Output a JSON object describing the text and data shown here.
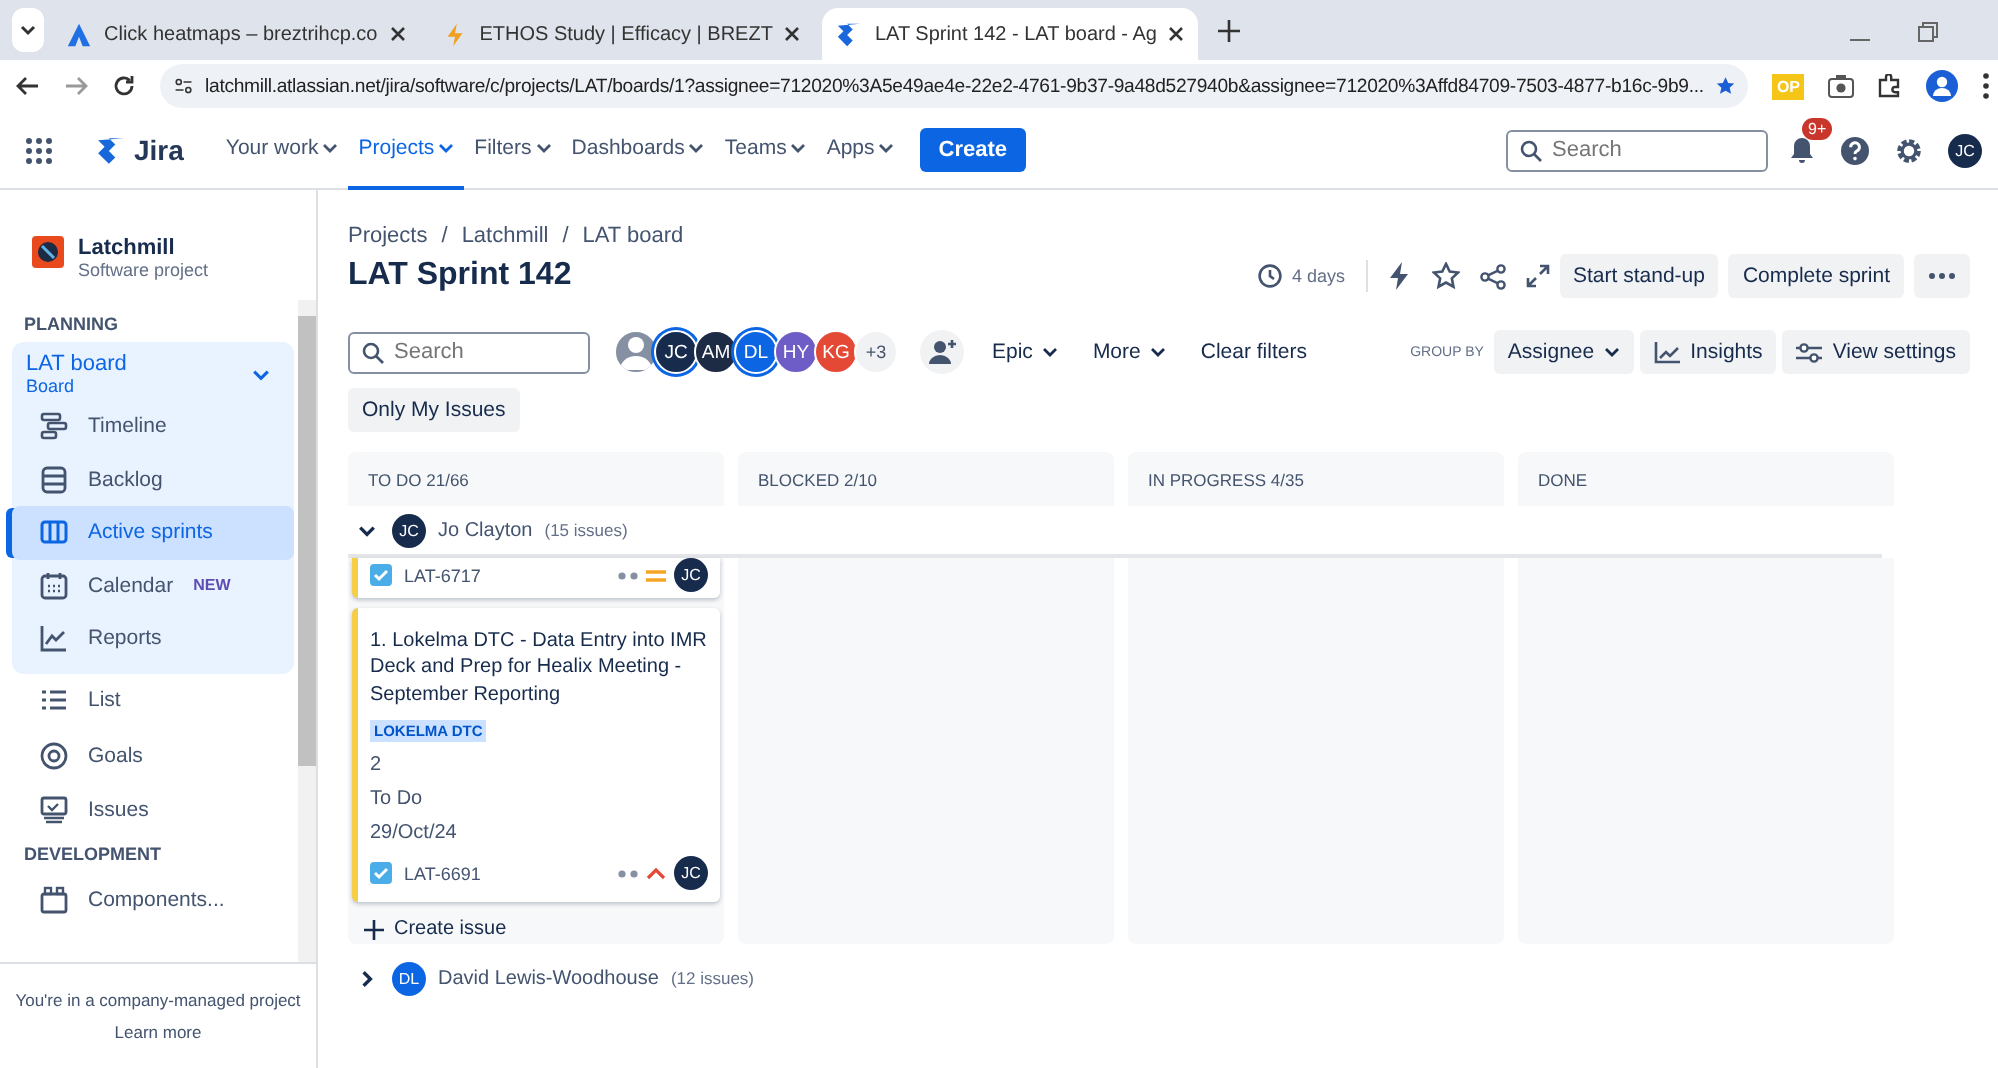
{
  "browser": {
    "tabs": [
      {
        "title": "Click heatmaps – breztrihcp.co",
        "kind": "triangle",
        "selected": false
      },
      {
        "title": "ETHOS Study | Efficacy | BREZT",
        "kind": "bolt",
        "selected": false
      },
      {
        "title": "LAT Sprint 142 - LAT board - Ag",
        "kind": "jira",
        "selected": true
      }
    ],
    "url": "latchmill.atlassian.net/jira/software/c/projects/LAT/boards/1?assignee=712020%3A5e49ae4e-22e2-4761-9b37-9a48d527940b&assignee=712020%3Affd84709-7503-4877-b16c-9b9...",
    "extension_badge": "OP"
  },
  "topnav": {
    "product": "Jira",
    "menus": [
      {
        "label": "Your work",
        "selected": false
      },
      {
        "label": "Projects",
        "selected": true
      },
      {
        "label": "Filters",
        "selected": false
      },
      {
        "label": "Dashboards",
        "selected": false
      },
      {
        "label": "Teams",
        "selected": false
      },
      {
        "label": "Apps",
        "selected": false
      }
    ],
    "create": "Create",
    "search_placeholder": "Search",
    "notifications": "9+",
    "user": "JC"
  },
  "sidebar": {
    "project": "Latchmill",
    "project_type": "Software project",
    "sections": [
      {
        "title": "PLANNING",
        "board": {
          "title": "LAT board",
          "subtitle": "Board",
          "expanded": true,
          "items": [
            {
              "label": "Timeline",
              "kind": "timeline",
              "selected": false
            },
            {
              "label": "Backlog",
              "kind": "backlog",
              "selected": false
            },
            {
              "label": "Active sprints",
              "kind": "columns",
              "selected": true
            },
            {
              "label": "Calendar",
              "kind": "calendar",
              "selected": false,
              "badge": "NEW"
            },
            {
              "label": "Reports",
              "kind": "chart",
              "selected": false
            }
          ]
        },
        "items": [
          {
            "label": "List",
            "kind": "list",
            "selected": false
          },
          {
            "label": "Goals",
            "kind": "target",
            "selected": false
          },
          {
            "label": "Issues",
            "kind": "issues",
            "selected": false
          }
        ]
      },
      {
        "title": "DEVELOPMENT",
        "items": [
          {
            "label": "Components...",
            "kind": "component",
            "selected": false
          }
        ]
      }
    ],
    "footer": "You're in a company-managed project",
    "footer_link": "Learn more"
  },
  "page": {
    "breadcrumbs": [
      "Projects",
      "Latchmill",
      "LAT board"
    ],
    "breadcrumb_separator": "/",
    "title": "LAT Sprint 142",
    "remaining": "4 days",
    "actions": [
      "Start stand-up",
      "Complete sprint"
    ],
    "filters": {
      "search_placeholder": "Search",
      "avatars": [
        {
          "color": "#8590a2",
          "selected": false
        },
        {
          "initials": "JC",
          "color": "#172b4d",
          "selected": true
        },
        {
          "initials": "AM",
          "color": "#1d2b45",
          "selected": false
        },
        {
          "initials": "DL",
          "color": "#0c66e4",
          "selected": true
        },
        {
          "initials": "HY",
          "color": "#6e5dc6",
          "selected": false
        },
        {
          "initials": "KG",
          "color": "#e34935",
          "selected": false
        }
      ],
      "more_count": "+3",
      "dropdowns": [
        "Epic",
        "More"
      ],
      "clear": "Clear filters",
      "group_by_label": "GROUP BY",
      "group_by": "Assignee",
      "insights": "Insights",
      "view_settings": "View settings",
      "only_mine": "Only My Issues"
    },
    "columns": [
      "TO DO 21/66",
      "BLOCKED 2/10",
      "IN PROGRESS 4/35",
      "DONE"
    ],
    "swimlanes": [
      {
        "initials": "JC",
        "color": "#172b4d",
        "name": "Jo Clayton",
        "count": "(15 issues)",
        "expanded": true,
        "cards": [
          {
            "kind": "stub",
            "key": "LAT-6717",
            "priority": {
              "kind": "medium"
            },
            "assignee": "JC"
          },
          {
            "kind": "full",
            "summary": "1. Lokelma DTC - Data Entry into IMR Deck and Prep for Healix Meeting - September Reporting",
            "epic": "LOKELMA DTC",
            "points": "2",
            "status": "To Do",
            "date": "29/Oct/24",
            "key": "LAT-6691",
            "priority": {
              "kind": "high"
            },
            "assignee": "JC"
          }
        ],
        "create": "Create issue"
      },
      {
        "initials": "DL",
        "color": "#0c66e4",
        "name": "David Lewis-Woodhouse",
        "count": "(12 issues)",
        "expanded": false
      }
    ]
  }
}
